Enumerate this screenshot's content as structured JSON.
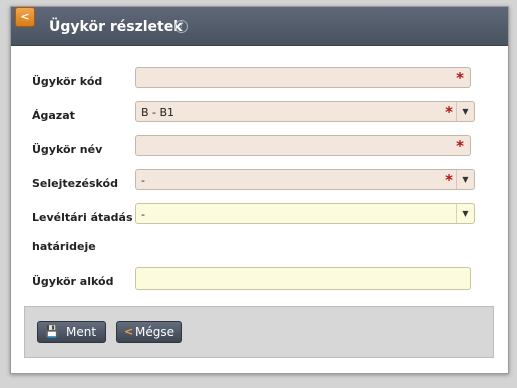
{
  "header": {
    "title": "Ügykör részletek",
    "back_icon": "<",
    "help_icon": "?"
  },
  "form": {
    "fields": [
      {
        "label": "Ügykör kód",
        "value": "",
        "required": true
      },
      {
        "label": "Ágazat",
        "value": "B - B1",
        "required": true
      },
      {
        "label": "Ügykör név",
        "value": "",
        "required": true
      },
      {
        "label": "Selejtezéskód",
        "value": "-",
        "required": true
      },
      {
        "label_line1": "Levéltári átadás",
        "label_line2": "határideje",
        "value": "-",
        "required": false
      },
      {
        "label": "Ügykör alkód",
        "value": "",
        "required": false
      }
    ],
    "required_mark": "*",
    "dropdown_arrow": "▼"
  },
  "footer": {
    "save_label": "Ment",
    "save_icon": "💾",
    "cancel_label": "Mégse",
    "cancel_icon": "<"
  },
  "colors": {
    "header": "#4f5866",
    "required_field": "#f3e7dd",
    "optional_field": "#fdfbdd",
    "required_star": "#b01818",
    "back_button": "#e48a24"
  }
}
